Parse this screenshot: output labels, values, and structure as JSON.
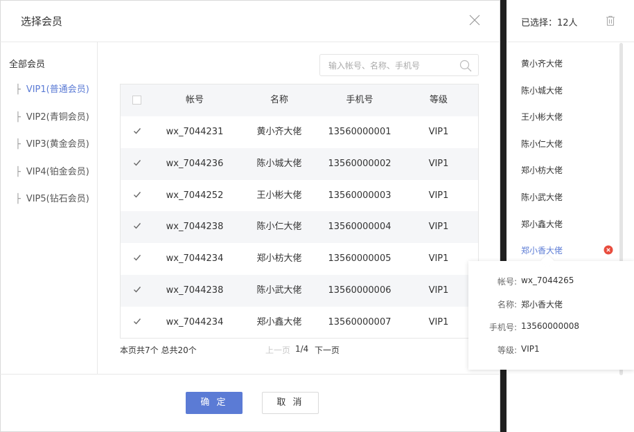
{
  "dialog": {
    "title": "选择会员",
    "confirm_label": "确 定",
    "cancel_label": "取 消"
  },
  "tree": {
    "root_label": "全部会员",
    "items": [
      {
        "label": "VIP1(普通会员)",
        "active": true
      },
      {
        "label": "VIP2(青铜会员)",
        "active": false
      },
      {
        "label": "VIP3(黄金会员)",
        "active": false
      },
      {
        "label": "VIP4(铂金会员)",
        "active": false
      },
      {
        "label": "VIP5(钻石会员)",
        "active": false
      }
    ]
  },
  "search": {
    "placeholder": "输入帐号、名称、手机号",
    "value": ""
  },
  "table": {
    "columns": [
      "帐号",
      "名称",
      "手机号",
      "等级"
    ],
    "rows": [
      {
        "account": "wx_7044231",
        "name": "黄小齐大佬",
        "phone": "13560000001",
        "level": "VIP1",
        "checked": true
      },
      {
        "account": "wx_7044236",
        "name": "陈小城大佬",
        "phone": "13560000002",
        "level": "VIP1",
        "checked": true
      },
      {
        "account": "wx_7044252",
        "name": "王小彬大佬",
        "phone": "13560000003",
        "level": "VIP1",
        "checked": true
      },
      {
        "account": "wx_7044238",
        "name": "陈小仁大佬",
        "phone": "13560000004",
        "level": "VIP1",
        "checked": true
      },
      {
        "account": "wx_7044234",
        "name": "郑小枋大佬",
        "phone": "13560000005",
        "level": "VIP1",
        "checked": true
      },
      {
        "account": "wx_7044238",
        "name": "陈小武大佬",
        "phone": "13560000006",
        "level": "VIP1",
        "checked": true
      },
      {
        "account": "wx_7044234",
        "name": "郑小鑫大佬",
        "phone": "13560000007",
        "level": "VIP1",
        "checked": true
      }
    ]
  },
  "pager": {
    "info": "本页共7个  总共20个",
    "prev_label": "上一页",
    "page": "1/4",
    "next_label": "下一页"
  },
  "selected": {
    "count_label": "已选择：12人",
    "items": [
      "黄小齐大佬",
      "陈小城大佬",
      "王小彬大佬",
      "陈小仁大佬",
      "郑小枋大佬",
      "陈小武大佬",
      "郑小鑫大佬",
      "郑小香大佬"
    ],
    "hover_index": 7
  },
  "popover": {
    "account_label": "帐号:",
    "account": "wx_7044265",
    "name_label": "名称:",
    "name": "郑小香大佬",
    "phone_label": "手机号:",
    "phone": "13560000008",
    "level_label": "等级:",
    "level": "VIP1"
  },
  "colors": {
    "accent": "#5b7bd5",
    "danger": "#e84c3d",
    "row_alt": "#f5f6f8"
  },
  "icons": [
    "close-icon",
    "search-icon",
    "check-icon",
    "trash-icon",
    "remove-circle-icon"
  ]
}
